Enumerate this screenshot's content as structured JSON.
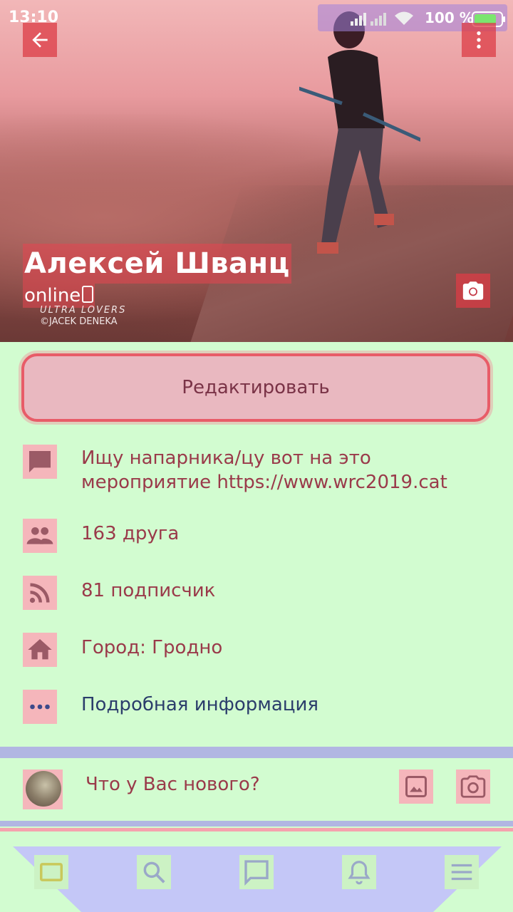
{
  "status_bar": {
    "time": "13:10",
    "battery_percent": "100 %"
  },
  "profile": {
    "name": "Алексей Шванц",
    "status": "online",
    "watermark_line1": "ULTRA LOVERS",
    "watermark_line2": "©JACEK DENEKA"
  },
  "actions": {
    "edit_label": "Редактировать"
  },
  "info": {
    "status_text": "Ищу напарника/цу вот на это мероприятие https://www.wrc2019.cat",
    "friends": "163 друга",
    "followers": "81 подписчик",
    "city": "Город: Гродно",
    "details": "Подробная информация"
  },
  "composer": {
    "prompt": "Что у Вас нового?"
  },
  "bottom_nav": {
    "items": [
      "news-icon",
      "search-icon",
      "messages-icon",
      "notifications-icon",
      "menu-icon"
    ]
  },
  "colors": {
    "accent": "#e85c68",
    "link": "#2b3d6b",
    "text": "#9a3a4a",
    "background": "#d2fcd0"
  }
}
